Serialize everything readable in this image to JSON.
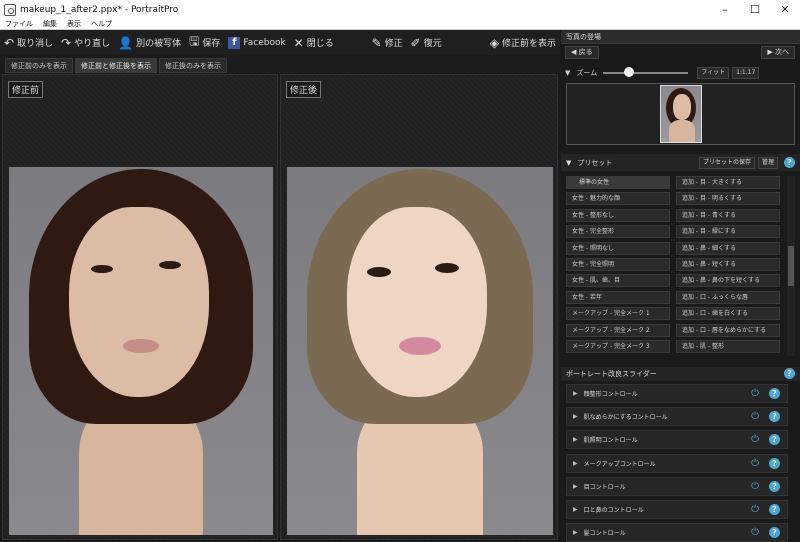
{
  "window": {
    "title": "makeup_1_after2.ppx* - PortraitPro"
  },
  "menu": [
    "ファイル",
    "編集",
    "表示",
    "ヘルプ"
  ],
  "toolbar": {
    "undo": "取り消し",
    "redo": "やり直し",
    "another_subject": "別の被写体",
    "save": "保存",
    "facebook": "Facebook",
    "close": "閉じる",
    "modify": "修正",
    "restore": "復元",
    "show_before": "修正前を表示"
  },
  "view_tabs": [
    "修正前のみを表示",
    "修正前と修正後を表示",
    "修正後のみを表示"
  ],
  "panes": {
    "before_label": "修正前",
    "after_label": "修正後"
  },
  "photo_section": {
    "title": "写真の登場",
    "back": "◀ 戻る",
    "next": "次へ",
    "zoom_label": "ズーム",
    "zoom_fraction": 0.3,
    "fit": "フィット",
    "zoom_value": "1:1.17"
  },
  "presets": {
    "title": "プリセット",
    "save_preset": "プリセットの保存",
    "manage": "管理",
    "items": [
      [
        "標準の女性",
        "追加 - 目 - 大きくする"
      ],
      [
        "女性 - 魅力的な顔",
        "追加 - 目 - 明るくする"
      ],
      [
        "女性 - 整形なし",
        "追加 - 目 - 青くする"
      ],
      [
        "女性 - 完全整形",
        "追加 - 目 - 緑にする"
      ],
      [
        "女性 - 照明なし",
        "追加 - 鼻 - 細くする"
      ],
      [
        "女性 - 完全照明",
        "追加 - 鼻 - 短くする"
      ],
      [
        "女性 - 肌、歯、目",
        "追加 - 鼻 - 鼻の下を短くする"
      ],
      [
        "女性 - 若年",
        "追加 - 口 - ふっくらな唇"
      ],
      [
        "メークアップ - 完全メーク 1",
        "追加 - 口 - 歯を白くする"
      ],
      [
        "メークアップ - 完全メーク 2",
        "追加 - 口 - 唇をなめらかにする"
      ],
      [
        "メークアップ - 完全メーク 3",
        "追加 - 肌 - 整形"
      ]
    ]
  },
  "sliders": {
    "title": "ポートレート改良スライダー",
    "items": [
      "顔整形コントロール",
      "肌なめらかにするコントロール",
      "肌照明コントロール",
      "メークアップコントロール",
      "目コントロール",
      "口と鼻のコントロール",
      "髪コントロール"
    ]
  },
  "colors": {
    "accent": "#4aa8d8",
    "before_hair": "#2e1a10",
    "after_hair": "#7a6a52"
  }
}
